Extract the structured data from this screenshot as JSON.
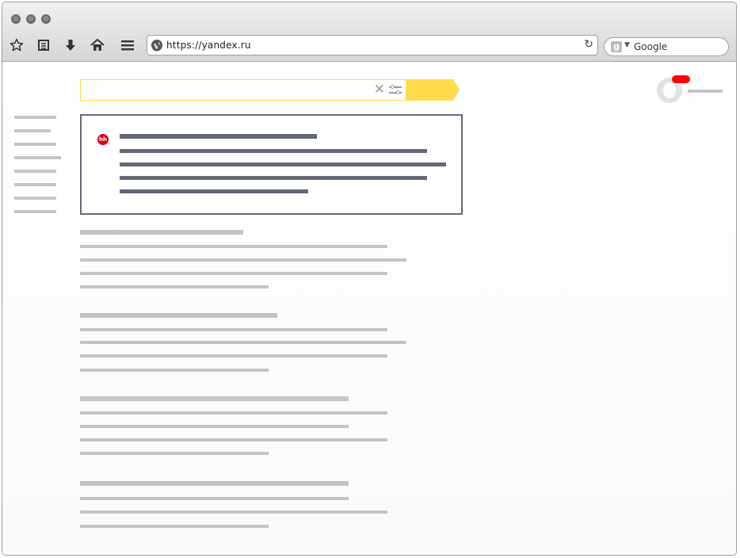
{
  "browser": {
    "url": "https://yandex.ru",
    "search_engine": "Google",
    "toolbar_icons": [
      "star-icon",
      "clipboard-icon",
      "download-icon",
      "home-icon",
      "menu-icon"
    ]
  },
  "colors": {
    "accent_yellow": "#ffdb4d",
    "placeholder_gray": "#c4c4c4",
    "promo_dark": "#636977",
    "notification_red": "#ff0000",
    "hh_red": "#d6001c"
  },
  "promo": {
    "badge": "hh"
  }
}
